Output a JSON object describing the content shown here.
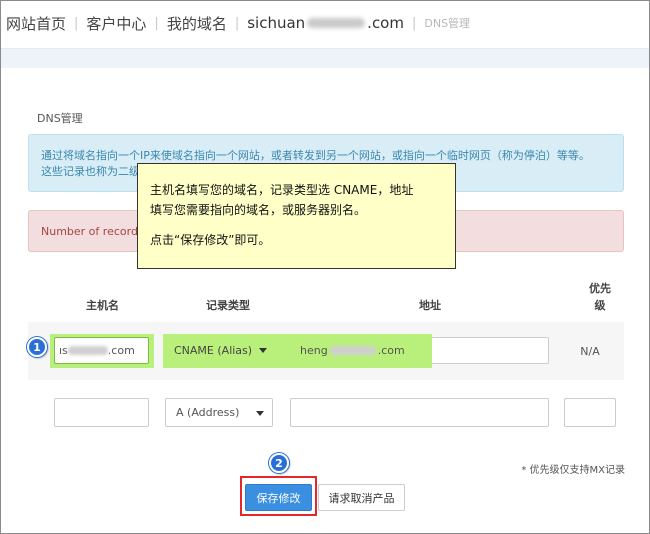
{
  "nav": {
    "home": "网站首页",
    "customer": "客户中心",
    "domains": "我的域名",
    "domain_prefix": "sichuan",
    "domain_suffix": ".com",
    "crumb": "DNS管理"
  },
  "section": {
    "title": "DNS管理",
    "info_line1": "通过将域名指向一个IP来使域名指向一个网站，或者转发到另一个网站，或指向一个临时网页（称为停泊）等等。",
    "info_line2_start": "这些记录也称为二级",
    "warning_start": "Number of records"
  },
  "tooltip": {
    "line1": "主机名填写您的域名，记录类型选 CNAME，地址",
    "line2": "填写您需要指向的域名，或服务器别名。",
    "line3": "点击“保存修改”即可。"
  },
  "table": {
    "headers": {
      "host": "主机名",
      "type": "记录类型",
      "address": "地址",
      "priority_l1": "优先",
      "priority_l2": "级"
    },
    "row1": {
      "host_start": "ıs",
      "host_end": ".com",
      "type": "CNAME (Alias)",
      "address_start": "heng",
      "address_end": ".com",
      "priority": "N/A"
    },
    "row2": {
      "host": "",
      "type": "A (Address)",
      "address": "",
      "priority": ""
    }
  },
  "note": "* 优先级仅支持MX记录",
  "buttons": {
    "save": "保存修改",
    "cancel": "请求取消产品"
  },
  "markers": {
    "one": "1",
    "two": "2"
  },
  "colors": {
    "highlight": "#b9f07b",
    "save_button": "#3b8fe0",
    "annotation_box": "#e5262a",
    "tooltip_bg": "#ffffc8",
    "info_bg": "#d9edf7",
    "warning_bg": "#f2dede"
  }
}
